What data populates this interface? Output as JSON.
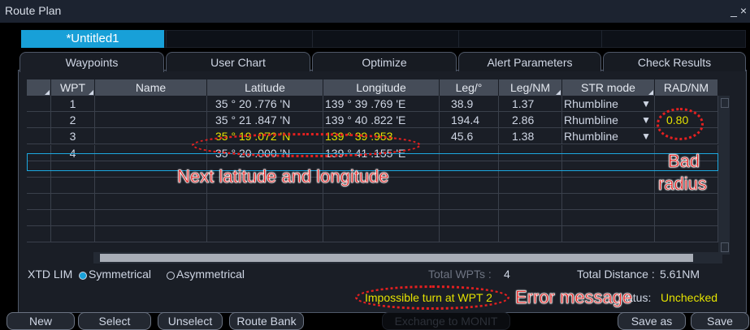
{
  "window": {
    "title": "Route Plan",
    "close": "_ ×"
  },
  "route_tab": {
    "label": "*Untitled1"
  },
  "tabs": [
    {
      "label": "Waypoints"
    },
    {
      "label": "User Chart"
    },
    {
      "label": "Optimize"
    },
    {
      "label": "Alert Parameters"
    },
    {
      "label": "Check Results"
    }
  ],
  "columns": [
    "",
    "WPT",
    "Name",
    "Latitude",
    "Longitude",
    "Leg/°",
    "Leg/NM",
    "STR mode",
    "RAD/NM"
  ],
  "rows": [
    {
      "wpt": "1",
      "name": "",
      "lat": "35 ° 20 .776 'N",
      "lon": "139 ° 39 .769 'E",
      "leg_deg": "38.9",
      "leg_nm": "1.37",
      "str": "Rhumbline",
      "rad": ""
    },
    {
      "wpt": "2",
      "name": "",
      "lat": "35 ° 21 .847 'N",
      "lon": "139 ° 40 .822 'E",
      "leg_deg": "194.4",
      "leg_nm": "2.86",
      "str": "Rhumbline",
      "rad": "0.80"
    },
    {
      "wpt": "3",
      "name": "",
      "lat": "35 ° 19 .072 'N",
      "lon": "139 ° 39 .953",
      "leg_deg": "45.6",
      "leg_nm": "1.38",
      "str": "Rhumbline",
      "rad": ""
    },
    {
      "wpt": "4",
      "name": "",
      "lat": "35 ° 20 .000 'N",
      "lon": "139 ° 41 .155 'E",
      "leg_deg": "",
      "leg_nm": "",
      "str": "",
      "rad": ""
    }
  ],
  "xtd": {
    "label": "XTD LIM",
    "option1": "Symmetrical",
    "option2": "Asymmetrical"
  },
  "totals": {
    "wpts_label": "Total WPTs :",
    "wpts_value": "4",
    "dist_label": "Total Distance :",
    "dist_value": "5.61NM"
  },
  "status": {
    "message": "Impossible turn at WPT 2",
    "status_label": "atus:",
    "status_value": "Unchecked"
  },
  "buttons": {
    "new": "New",
    "select": "Select",
    "unselect": "Unselect",
    "route_bank": "Route Bank",
    "exchange": "Exchange to MONIT",
    "save_as": "Save as",
    "save": "Save"
  },
  "annotations": {
    "bad_radius_1": "Bad",
    "bad_radius_2": "radius",
    "next_latlon": "Next latitude and longitude",
    "error_message": "Error message"
  },
  "colors": {
    "highlight_yellow": "#e4e200",
    "accent_blue": "#18a0d8",
    "annotation_red": "#e21b1b",
    "row_select_border": "#1ca8e0"
  }
}
